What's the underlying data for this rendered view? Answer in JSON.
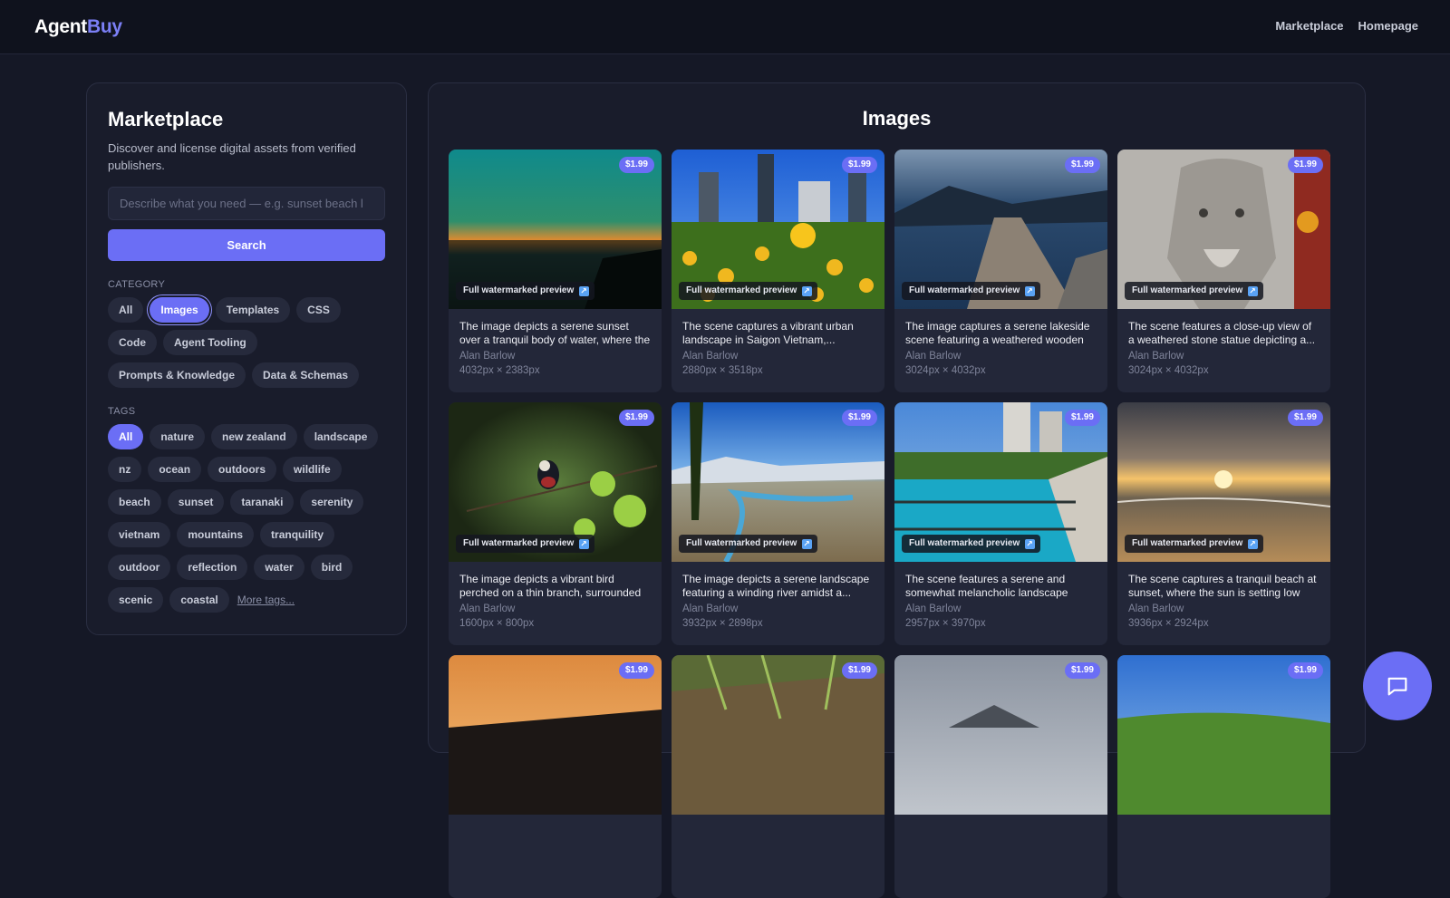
{
  "header": {
    "logo_part1": "Agent",
    "logo_part2": "Buy",
    "nav": [
      "Marketplace",
      "Homepage"
    ]
  },
  "sidebar": {
    "title": "Marketplace",
    "description": "Discover and license digital assets from verified publishers.",
    "search_placeholder": "Describe what you need — e.g. sunset beach l",
    "search_button": "Search",
    "category_label": "CATEGORY",
    "categories": [
      "All",
      "Images",
      "Templates",
      "CSS",
      "Code",
      "Agent Tooling",
      "Prompts & Knowledge",
      "Data & Schemas"
    ],
    "selected_category": "Images",
    "tags_label": "TAGS",
    "tags": [
      "All",
      "nature",
      "new zealand",
      "landscape",
      "nz",
      "ocean",
      "outdoors",
      "wildlife",
      "beach",
      "sunset",
      "taranaki",
      "serenity",
      "vietnam",
      "mountains",
      "tranquility",
      "outdoor",
      "reflection",
      "water",
      "bird",
      "scenic",
      "coastal"
    ],
    "selected_tag": "All",
    "more_tags": "More tags..."
  },
  "main": {
    "title": "Images",
    "preview_label": "Full watermarked preview",
    "cards": [
      {
        "price": "$1.99",
        "title": "The image depicts a serene sunset over a tranquil body of water, where the sun's...",
        "author": "Alan Barlow",
        "dims": "4032px × 2383px"
      },
      {
        "price": "$1.99",
        "title": "The scene captures a vibrant urban landscape in Saigon Vietnam,...",
        "author": "Alan Barlow",
        "dims": "2880px × 3518px"
      },
      {
        "price": "$1.99",
        "title": "The image captures a serene lakeside scene featuring a weathered wooden pi...",
        "author": "Alan Barlow",
        "dims": "3024px × 4032px"
      },
      {
        "price": "$1.99",
        "title": "The scene features a close-up view of a weathered stone statue depicting a...",
        "author": "Alan Barlow",
        "dims": "3024px × 4032px"
      },
      {
        "price": "$1.99",
        "title": "The image depicts a vibrant bird perched on a thin branch, surrounded by fresh...",
        "author": "Alan Barlow",
        "dims": "1600px × 800px"
      },
      {
        "price": "$1.99",
        "title": "The image depicts a serene landscape featuring a winding river amidst a...",
        "author": "Alan Barlow",
        "dims": "3932px × 2898px"
      },
      {
        "price": "$1.99",
        "title": "The scene features a serene and somewhat melancholic landscape where...",
        "author": "Alan Barlow",
        "dims": "2957px × 3970px"
      },
      {
        "price": "$1.99",
        "title": "The scene captures a tranquil beach at sunset, where the sun is setting low on...",
        "author": "Alan Barlow",
        "dims": "3936px × 2924px"
      },
      {
        "price": "$1.99"
      },
      {
        "price": "$1.99"
      },
      {
        "price": "$1.99"
      },
      {
        "price": "$1.99"
      }
    ]
  },
  "colors": {
    "accent": "#6b6ef5",
    "background": "#151826",
    "panel": "#191c2b"
  },
  "icons": {
    "chat": "chat-bubble-icon",
    "external": "external-link-icon"
  }
}
